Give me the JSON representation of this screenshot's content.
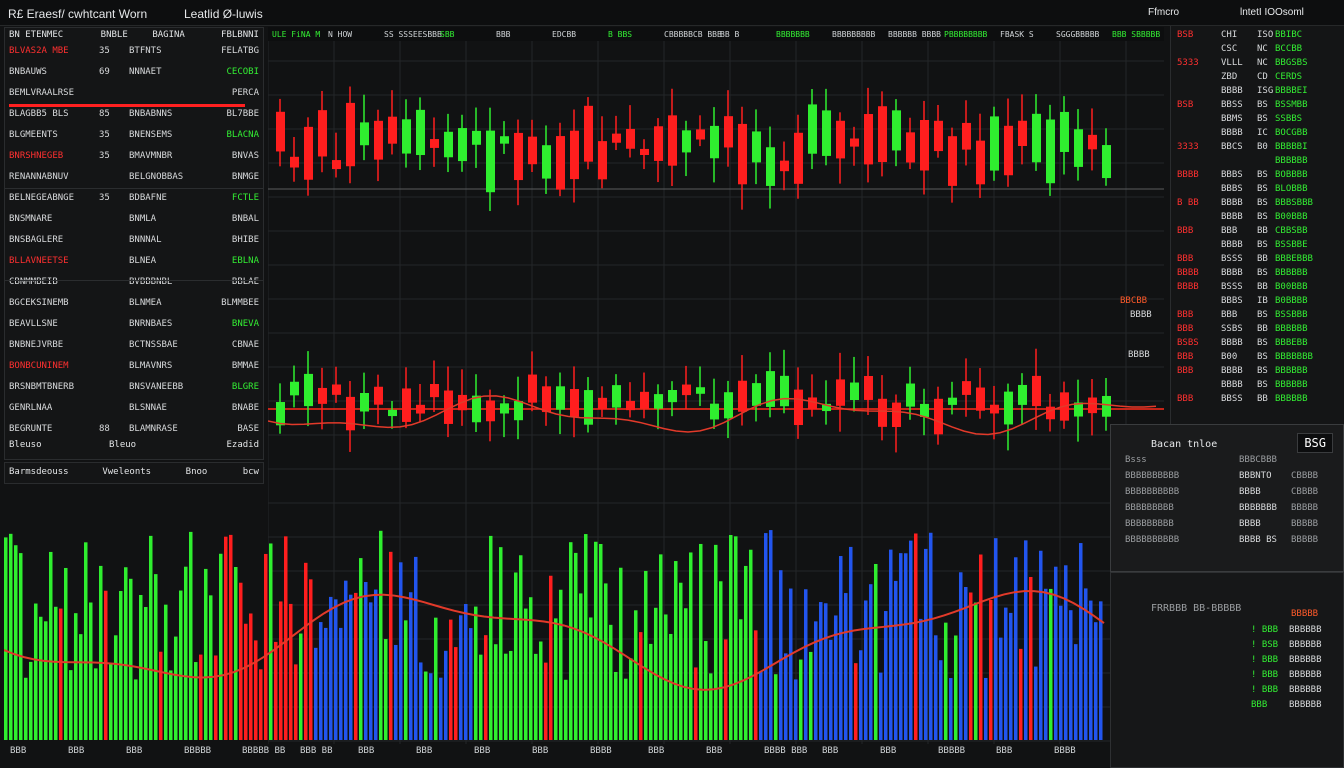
{
  "header": {
    "title": "R£ Eraesf/ cwhtcant Worn",
    "subtitle": "Leatlid Ø-luwis",
    "right_label": "Ffmcro",
    "right_value": "lntetI IOOsoml"
  },
  "left_panel": {
    "top_header": [
      "BN ETENMEC",
      "BNBLE",
      "BAGINA",
      "FBLBNNI"
    ],
    "rows": [
      [
        "BLVAS2A MBE",
        "35",
        "BTFNTS",
        "FELATBG"
      ],
      [
        "BNBAUWS",
        "69",
        "NNNAET",
        "CECOBI"
      ],
      [
        "BEMLVRAALRSE",
        "",
        "",
        "PERCA"
      ],
      [
        "BLAGBB5 BLS",
        "85",
        "BNBABNNS",
        "BL7BBE"
      ],
      [
        "BLGMEENTS",
        "35",
        "BNENSEMS",
        "BLACNA"
      ],
      [
        "BNRSHNEGEB",
        "35",
        "BMAVMNBR",
        "BNVAS"
      ],
      [
        "RENANNABNUV",
        "",
        "BELGNOBBAS",
        "BNMGE"
      ],
      [
        "BELNEGEABNGE",
        "35",
        "BDBAFNE",
        "FCTLE"
      ],
      [
        "BNSMNARE",
        "",
        "BNMLA",
        "BNBAL"
      ],
      [
        "BNSBAGLERE",
        "",
        "BNNNAL",
        "BHIBE"
      ],
      [
        "BLLAVNEETSE",
        "",
        "BLNEA",
        "EBLNA"
      ],
      [
        "CBNMMBEIB",
        "",
        "BVBBBNBL",
        "BBLAE"
      ],
      [
        "BGCEKSINEMB",
        "",
        "BLNMEA",
        "BLMMBEE"
      ],
      [
        "BEAVLLSNE",
        "",
        "BNRNBAES",
        "BNEVA"
      ],
      [
        "BNBNEJVRBE",
        "",
        "BCTNSSBAE",
        "CBNAE"
      ],
      [
        "BONBCUNINEM",
        "",
        "BLMAVNRS",
        "BMMAE"
      ],
      [
        "BRSNBMTBNERB",
        "",
        "BNSVANEEBB",
        "BLGRE"
      ],
      [
        "GENRLNAA",
        "",
        "BLSNNAE",
        "BNABE"
      ],
      [
        "BEGRUNTE",
        "88",
        "BLAMNRASE",
        "BASE"
      ]
    ],
    "footer": [
      "Bleuso",
      "Bleuo",
      "Ezadid"
    ],
    "sub_header": [
      "Barmsdeouss",
      "Vweleonts",
      "Bnoo",
      "bcw"
    ]
  },
  "top_ticker": [
    "ULE  FiNA M",
    "N HOW",
    "SS  SSSEESBBB",
    "SBB",
    "BBB",
    "EDCBB",
    "B BBS",
    "CBBBBBCB BBB",
    "BB B",
    "BBBBBBB",
    "BBBBBBBBB",
    "BBBBBB BBBB",
    "PBBBBBBBB",
    "FBASK S",
    "SGGGBBBBB",
    "BBB SBBBBB"
  ],
  "right_prices": [
    [
      "BSB",
      "CHI",
      "ISO",
      "BBIBC"
    ],
    [
      "",
      "CSC",
      "NC",
      "BCCBB"
    ],
    [
      "5333",
      "VLLL",
      "NC",
      "BBGSBS"
    ],
    [
      "",
      "ZBD",
      "CD",
      "CERDS"
    ],
    [
      "",
      "BBBB",
      "ISG",
      "BBBBEI"
    ],
    [
      "BSB",
      "BBSS",
      "BS",
      "BSSMBB"
    ],
    [
      "",
      "BBMS",
      "BS",
      "SSBBS"
    ],
    [
      "",
      "BBBB",
      "IC",
      "BOCGBB"
    ],
    [
      "3333",
      "BBCS",
      "B0",
      "BBBBBI"
    ],
    [
      "",
      "",
      "",
      "BBBBBB"
    ],
    [
      "BBBB",
      "BBBS",
      "BS",
      "BOBBBB"
    ],
    [
      "",
      "BBBS",
      "BS",
      "BLOBBB"
    ],
    [
      "B BB",
      "BBBB",
      "BS",
      "BBBSBBB"
    ],
    [
      "",
      "BBBB",
      "BS",
      "B00BBB"
    ],
    [
      "BBB",
      "BBB",
      "BB",
      "CBBSBB"
    ],
    [
      "",
      "BBBB",
      "BS",
      "BSSBBE"
    ],
    [
      "BBB",
      "BSSS",
      "BB",
      "BBBEBBB"
    ],
    [
      "BBBB",
      "BBBB",
      "BS",
      "BBBBBB"
    ],
    [
      "BBBB",
      "BSSS",
      "BB",
      "B00BBB"
    ],
    [
      "",
      "BBBS",
      "IB",
      "B0BBBB"
    ],
    [
      "BBB",
      "BBB",
      "BS",
      "BSSBBB"
    ],
    [
      "BBB",
      "SSBS",
      "BB",
      "BBBBBB"
    ],
    [
      "BSBS",
      "BBBB",
      "BS",
      "BBBEBB"
    ],
    [
      "BBB",
      "B00",
      "BS",
      "BBBBBBB"
    ],
    [
      "BBB",
      "BBBB",
      "BS",
      "BBBBBB"
    ],
    [
      "",
      "BBBB",
      "BS",
      "BBBBBB"
    ],
    [
      "BBB",
      "BBSS",
      "BB",
      "BBBBBB"
    ]
  ],
  "order_panel": {
    "title": "Bacan tnloe",
    "badge": "BSG",
    "rows": [
      [
        "Bsss",
        "BBBCBBB"
      ],
      [
        "BBBBBBBBBB",
        "BBBNTO",
        "CBBBB"
      ],
      [
        "BBBBBBBBBB",
        "BBBB",
        "CBBBB"
      ],
      [
        "BBBBBBBBB",
        "BBBBBBB",
        "BBBBB"
      ],
      [
        "BBBBBBBBB",
        "BBBB",
        "BBBBB"
      ],
      [
        "BBBBBBBBBB",
        "BBBB BS",
        "BBBBB"
      ]
    ],
    "section2_title": "FRRBBB BB-BBBBB",
    "section2_value": "BBBBB",
    "section2_rows": [
      [
        "! BBB",
        "BBBBBB"
      ],
      [
        "! BSB",
        "BBBBBB"
      ],
      [
        "! BBB",
        "BBBBBB"
      ],
      [
        "! BBB",
        "BBBBBB"
      ],
      [
        "! BBB",
        "BBBBBB"
      ],
      [
        "BBB",
        "BBBBBB"
      ]
    ]
  },
  "side_labels": {
    "price_tag_1": "BBCBB",
    "price_tag_2": "BBBB",
    "price_tag_3": "BBBB"
  },
  "bottom_axis": [
    "BBB",
    "BBB",
    "BBB",
    "BBBBB",
    "BBBBB BB",
    "BBB BB",
    "BBB",
    "BBB",
    "BBB",
    "BBB",
    "BBBB",
    "BBB",
    "BBB",
    "BBBB BBB",
    "BBB",
    "BBB",
    "BBBBB",
    "BBB",
    "BBBB"
  ],
  "colors": {
    "bull": "#2fee2f",
    "bear": "#ff1e1e",
    "volume_blue": "#2255ee",
    "ma": "#e23a2a"
  }
}
